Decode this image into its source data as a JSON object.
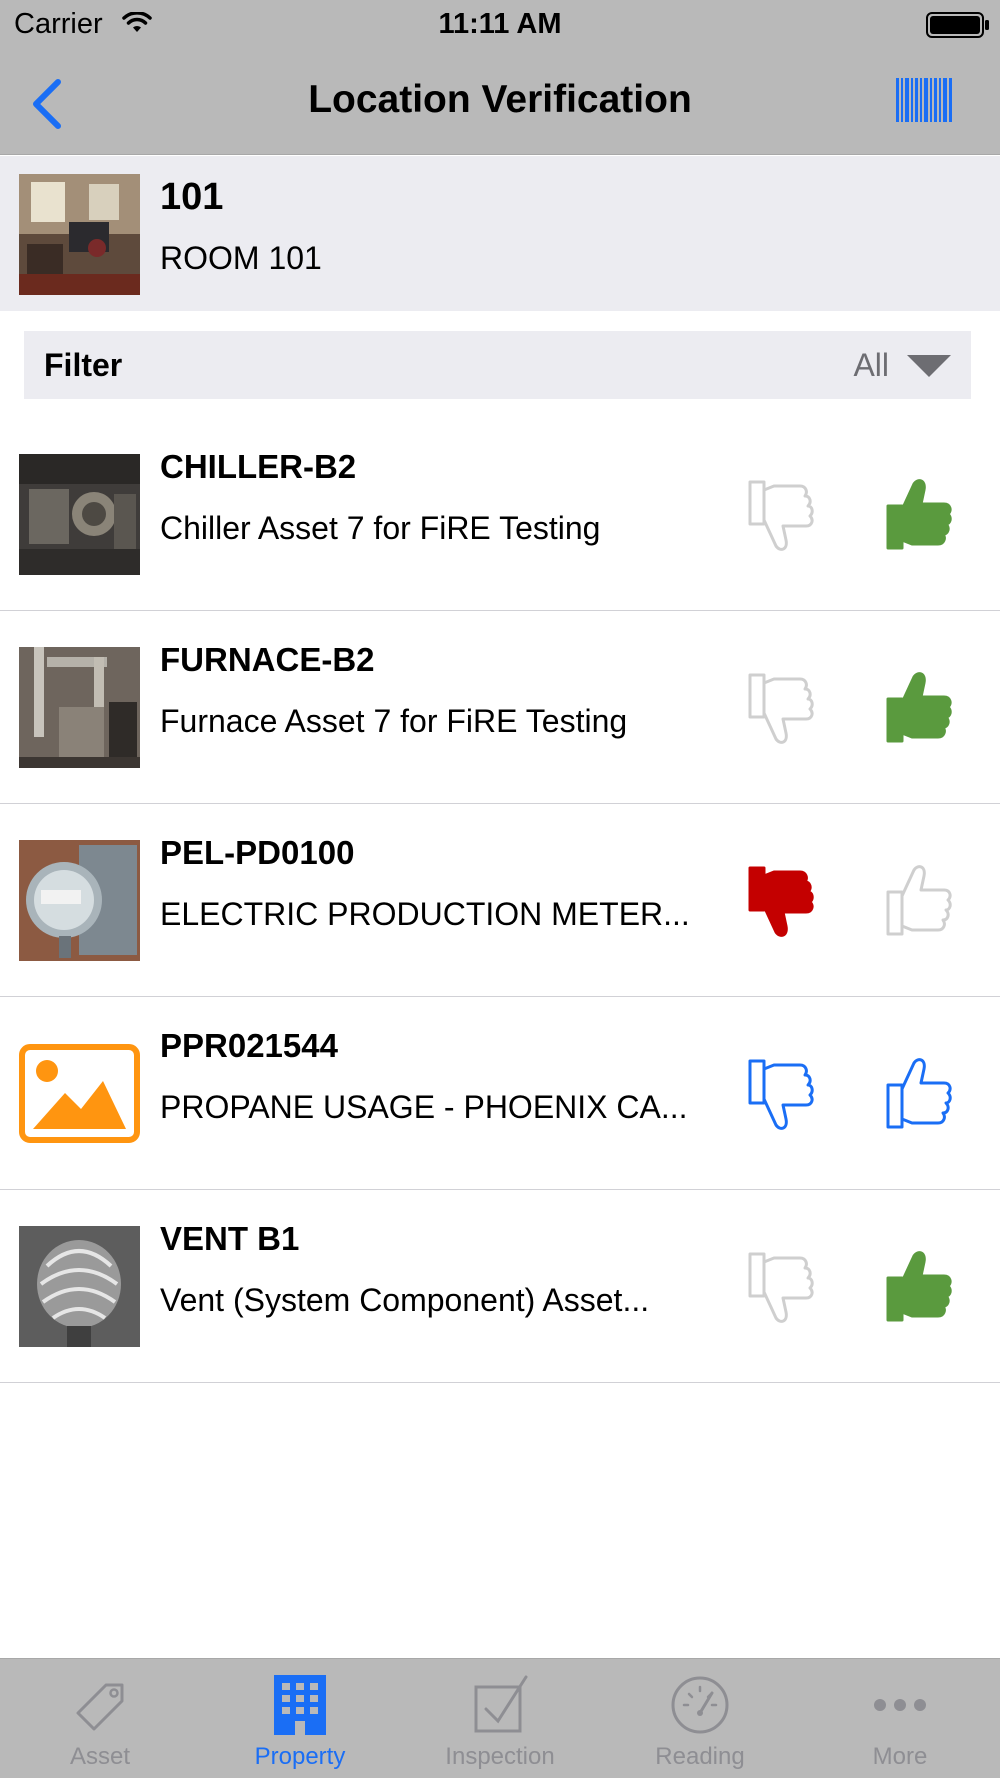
{
  "status_bar": {
    "carrier": "Carrier",
    "time": "11:11 AM"
  },
  "nav": {
    "title": "Location Verification",
    "back_icon": "chevron-left-icon",
    "barcode_icon": "barcode-icon",
    "accent_color": "#1a6ef5"
  },
  "location": {
    "code": "101",
    "name": "ROOM 101"
  },
  "filter": {
    "label": "Filter",
    "value": "All"
  },
  "assets": [
    {
      "code": "CHILLER-B2",
      "description": "Chiller Asset 7 for FiRE Testing",
      "thumb_down": "inactive",
      "thumb_up": "green"
    },
    {
      "code": "FURNACE-B2",
      "description": "Furnace Asset 7 for FiRE Testing",
      "thumb_down": "inactive",
      "thumb_up": "green"
    },
    {
      "code": "PEL-PD0100",
      "description": "ELECTRIC PRODUCTION METER...",
      "thumb_down": "red",
      "thumb_up": "inactive"
    },
    {
      "code": "PPR021544",
      "description": "PROPANE USAGE - PHOENIX CA...",
      "thumb_down": "blue-outline",
      "thumb_up": "blue-outline"
    },
    {
      "code": "VENT B1",
      "description": "Vent (System Component) Asset...",
      "thumb_down": "inactive",
      "thumb_up": "green"
    }
  ],
  "tabs": [
    {
      "label": "Asset",
      "icon": "tag-icon",
      "active": false
    },
    {
      "label": "Property",
      "icon": "building-icon",
      "active": true
    },
    {
      "label": "Inspection",
      "icon": "checkbox-icon",
      "active": false
    },
    {
      "label": "Reading",
      "icon": "gauge-icon",
      "active": false
    },
    {
      "label": "More",
      "icon": "more-icon",
      "active": false
    }
  ],
  "colors": {
    "green": "#5a9a3e",
    "red": "#c40000",
    "blue": "#1a6ef5",
    "inactive": "#cfcfcf",
    "placeholder_orange": "#ff9510"
  }
}
